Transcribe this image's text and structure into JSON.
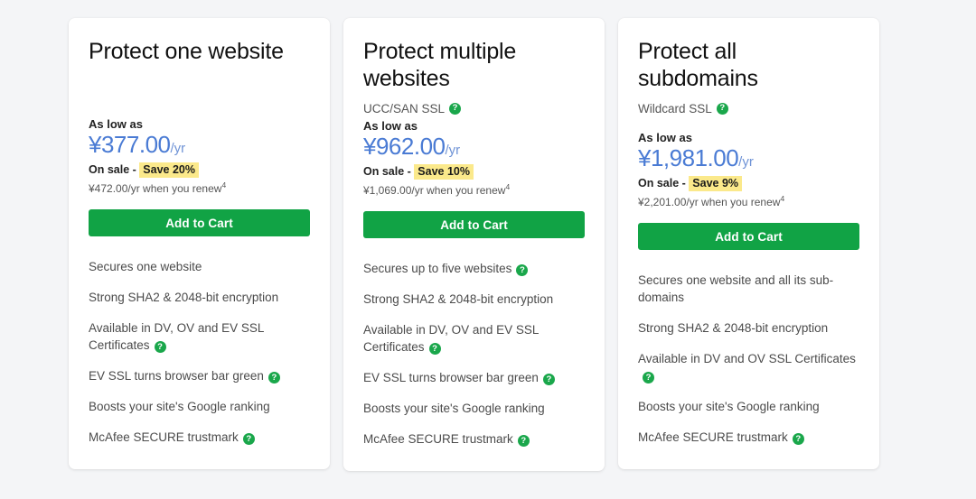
{
  "page": {
    "background_color": "#f4f5f7",
    "accent_green": "#11a345",
    "price_blue": "#4a7bd4",
    "save_highlight": "#fbe98b"
  },
  "labels": {
    "as_low_as": "As low as",
    "on_sale_prefix": "On sale - ",
    "add_to_cart": "Add to Cart",
    "help_glyph": "?"
  },
  "plans": [
    {
      "title": "Protect one website",
      "subtitle": "",
      "has_subtitle_help": false,
      "price_amount": "¥377.00",
      "price_period": "/yr",
      "save_text": "Save 20%",
      "renew_text": "¥472.00/yr when you renew",
      "renew_footnote": "4",
      "add_to_cart": "Add to Cart",
      "features": [
        {
          "text": "Secures one website",
          "help": false
        },
        {
          "text": "Strong SHA2 & 2048-bit encryption",
          "help": false
        },
        {
          "text": "Available in DV, OV and EV SSL Certificates",
          "help": true
        },
        {
          "text": "EV SSL turns browser bar green",
          "help": true
        },
        {
          "text": "Boosts your site's Google ranking",
          "help": false
        },
        {
          "text": "McAfee SECURE trustmark",
          "help": true
        }
      ]
    },
    {
      "title": "Protect multiple websites",
      "subtitle": "UCC/SAN SSL",
      "has_subtitle_help": true,
      "price_amount": "¥962.00",
      "price_period": "/yr",
      "save_text": "Save 10%",
      "renew_text": "¥1,069.00/yr when you renew",
      "renew_footnote": "4",
      "add_to_cart": "Add to Cart",
      "features": [
        {
          "text": "Secures up to five websites",
          "help": true
        },
        {
          "text": "Strong SHA2 & 2048-bit encryption",
          "help": false
        },
        {
          "text": "Available in DV, OV and EV SSL Certificates",
          "help": true
        },
        {
          "text": "EV SSL turns browser bar green",
          "help": true
        },
        {
          "text": "Boosts your site's Google ranking",
          "help": false
        },
        {
          "text": "McAfee SECURE trustmark",
          "help": true
        }
      ]
    },
    {
      "title": "Protect all subdomains",
      "subtitle": "Wildcard SSL",
      "has_subtitle_help": true,
      "price_amount": "¥1,981.00",
      "price_period": "/yr",
      "save_text": "Save 9%",
      "renew_text": "¥2,201.00/yr when you renew",
      "renew_footnote": "4",
      "add_to_cart": "Add to Cart",
      "features": [
        {
          "text": "Secures one website and all its sub-domains",
          "help": false
        },
        {
          "text": "Strong SHA2 & 2048-bit encryption",
          "help": false
        },
        {
          "text": "Available in DV and OV SSL Certificates",
          "help": true
        },
        {
          "text": "Boosts your site's Google ranking",
          "help": false
        },
        {
          "text": "McAfee SECURE trustmark",
          "help": true
        }
      ]
    }
  ]
}
